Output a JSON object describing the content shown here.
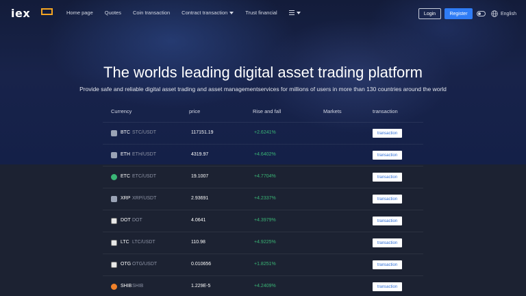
{
  "brand": {
    "logo_text": "iex",
    "accent_color": "#f5a623"
  },
  "nav": {
    "items": [
      {
        "label": "Home page",
        "dropdown": false
      },
      {
        "label": "Quotes",
        "dropdown": false
      },
      {
        "label": "Coin transaction",
        "dropdown": false
      },
      {
        "label": "Contract transaction",
        "dropdown": true
      },
      {
        "label": "Trust financial",
        "dropdown": false
      }
    ],
    "more_icon": "list-icon"
  },
  "header": {
    "login_label": "Login",
    "register_label": "Register",
    "register_color": "#2f7cf6",
    "language_label": "English"
  },
  "hero": {
    "title": "The worlds leading digital asset trading platform",
    "subtitle": "Provide safe and reliable digital asset trading and asset managementservices for millions of users in more than 130 countries around the world"
  },
  "table": {
    "columns": [
      "Currency",
      "price",
      "Rise and fall",
      "Markets",
      "transaction"
    ],
    "rows": [
      {
        "symbol": "BTC",
        "pair": "STC/USDT",
        "price": "117151.19",
        "change": "+2.6241%",
        "action": "transaction",
        "icon": "btc-icon",
        "icon_color": "#9aa3b5"
      },
      {
        "symbol": "ETH",
        "pair": "ETH/USDT",
        "price": "4319.97",
        "change": "+4.6402%",
        "action": "transaction",
        "icon": "eth-icon",
        "icon_color": "#9aa3b5"
      },
      {
        "symbol": "ETC",
        "pair": "ETC/USDT",
        "price": "19.1007",
        "change": "+4.7704%",
        "action": "transaction",
        "icon": "etc-icon",
        "icon_color": "#3ab676"
      },
      {
        "symbol": "XRP",
        "pair": "XRP/USDT",
        "price": "2.93691",
        "change": "+4.2337%",
        "action": "transaction",
        "icon": "xrp-icon",
        "icon_color": "#9aa3b5"
      },
      {
        "symbol": "DOT",
        "pair": "DOT",
        "price": "4.0641",
        "change": "+4.3979%",
        "action": "transaction",
        "icon": "dot-icon",
        "icon_color": "#e8e8e8"
      },
      {
        "symbol": "LTC",
        "pair": "LTC/USDT",
        "price": "110.98",
        "change": "+4.9225%",
        "action": "transaction",
        "icon": "ltc-icon",
        "icon_color": "#e8e8e8"
      },
      {
        "symbol": "OTG",
        "pair": "OTG/USDT",
        "price": "0.010656",
        "change": "+1.8251%",
        "action": "transaction",
        "icon": "otg-icon",
        "icon_color": "#e8e8e8"
      },
      {
        "symbol": "SHIB",
        "pair": "SHIB",
        "price": "1.229E-5",
        "change": "+4.2409%",
        "action": "transaction",
        "icon": "shib-icon",
        "icon_color": "#f0812a"
      }
    ],
    "positive_color": "#3ab676"
  }
}
